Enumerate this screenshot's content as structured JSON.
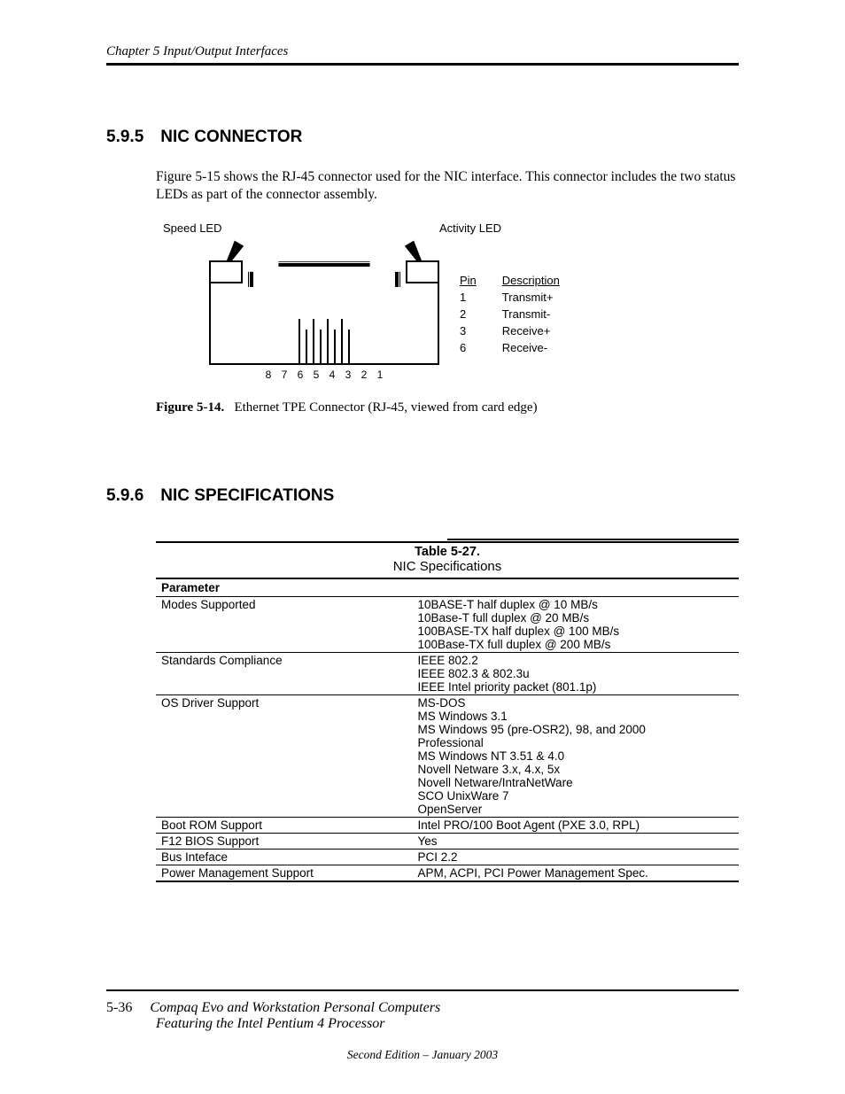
{
  "running_head": "Chapter 5  Input/Output Interfaces",
  "sections": {
    "s1": {
      "num": "5.9.5",
      "title": "NIC CONNECTOR"
    },
    "s2": {
      "num": "5.9.6",
      "title": "NIC SPECIFICATIONS"
    }
  },
  "para1": "Figure 5-15 shows the RJ-45 connector used for the NIC interface. This connector includes the two status LEDs as part of the connector assembly.",
  "figure": {
    "speed_label": "Speed LED",
    "activity_label": "Activity LED",
    "pin_numbers": "8  7  6  5  4  3  2  1",
    "pinhdr_pin": "Pin",
    "pinhdr_desc": "Description",
    "pins": [
      {
        "pin": "1",
        "desc": "Transmit+"
      },
      {
        "pin": "2",
        "desc": "Transmit-"
      },
      {
        "pin": "3",
        "desc": "Receive+"
      },
      {
        "pin": "6",
        "desc": "Receive-"
      }
    ],
    "caption_label": "Figure 5-14.",
    "caption_text": "Ethernet TPE Connector (RJ-45, viewed from card edge)"
  },
  "table": {
    "number": "Table 5-27.",
    "name": "NIC Specifications",
    "header": "Parameter",
    "rows": [
      {
        "param": "Modes Supported",
        "value": "10BASE-T half duplex @ 10 MB/s\n10Base-T full duplex @ 20 MB/s\n100BASE-TX half duplex @ 100 MB/s\n100Base-TX full duplex @ 200 MB/s"
      },
      {
        "param": "Standards Compliance",
        "value": "IEEE 802.2\nIEEE 802.3 & 802.3u\nIEEE Intel priority packet (801.1p)"
      },
      {
        "param": "OS Driver Support",
        "value": "MS-DOS\nMS Windows 3.1\nMS Windows 95 (pre-OSR2), 98, and 2000\nProfessional\nMS Windows NT 3.51 & 4.0\nNovell Netware 3.x, 4.x, 5x\nNovell Netware/IntraNetWare\nSCO UnixWare 7\nOpenServer"
      },
      {
        "param": "Boot ROM Support",
        "value": "Intel PRO/100 Boot Agent (PXE 3.0, RPL)"
      },
      {
        "param": "F12 BIOS Support",
        "value": "Yes"
      },
      {
        "param": "Bus Inteface",
        "value": "PCI 2.2"
      },
      {
        "param": "Power Management Support",
        "value": "APM, ACPI, PCI Power Management Spec."
      }
    ]
  },
  "footer": {
    "pgnum": "5-36",
    "line1": "Compaq Evo and Workstation Personal Computers",
    "line2": "Featuring the Intel Pentium 4 Processor",
    "edition": "Second Edition – January 2003"
  }
}
